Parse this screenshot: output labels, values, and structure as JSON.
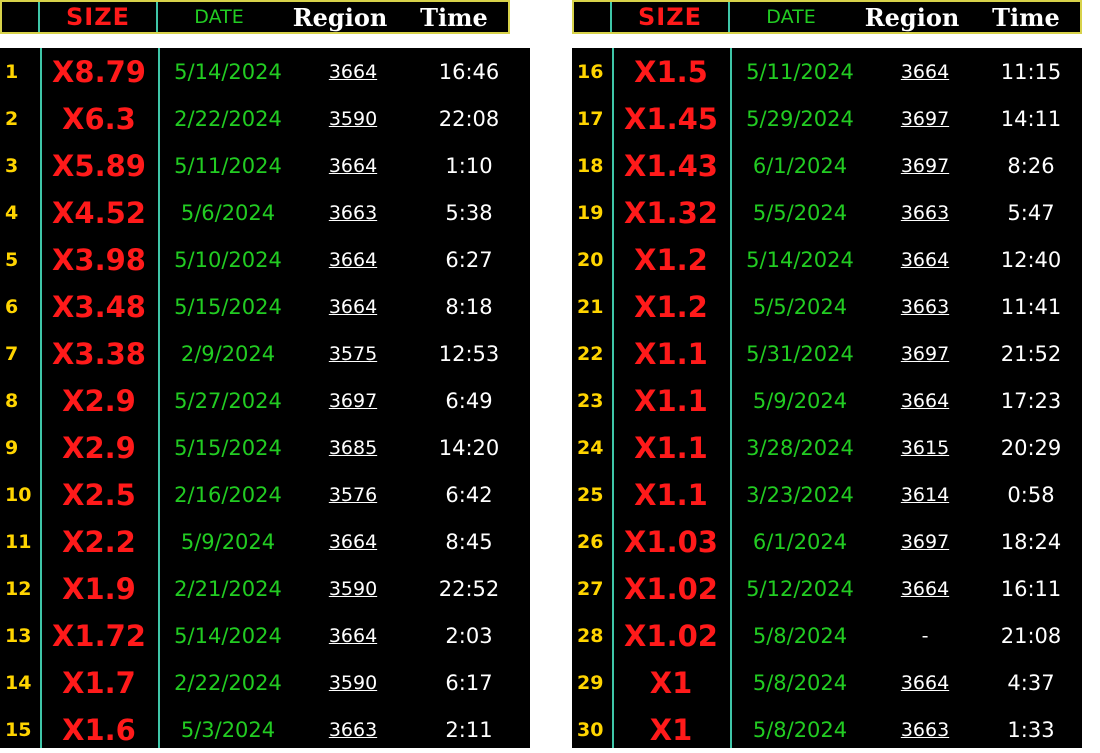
{
  "headers": {
    "num": "",
    "size": "SIZE",
    "date": "DATE",
    "region": "Region",
    "time": "Time"
  },
  "left_rows": [
    {
      "num": "1",
      "size": "X8.79",
      "date": "5/14/2024",
      "region": "3664",
      "time": "16:46"
    },
    {
      "num": "2",
      "size": "X6.3",
      "date": "2/22/2024",
      "region": "3590",
      "time": "22:08"
    },
    {
      "num": "3",
      "size": "X5.89",
      "date": "5/11/2024",
      "region": "3664",
      "time": "1:10"
    },
    {
      "num": "4",
      "size": "X4.52",
      "date": "5/6/2024",
      "region": "3663",
      "time": "5:38"
    },
    {
      "num": "5",
      "size": "X3.98",
      "date": "5/10/2024",
      "region": "3664",
      "time": "6:27"
    },
    {
      "num": "6",
      "size": "X3.48",
      "date": "5/15/2024",
      "region": "3664",
      "time": "8:18"
    },
    {
      "num": "7",
      "size": "X3.38",
      "date": "2/9/2024",
      "region": "3575",
      "time": "12:53"
    },
    {
      "num": "8",
      "size": "X2.9",
      "date": "5/27/2024",
      "region": "3697",
      "time": "6:49"
    },
    {
      "num": "9",
      "size": "X2.9",
      "date": "5/15/2024",
      "region": "3685",
      "time": "14:20"
    },
    {
      "num": "10",
      "size": "X2.5",
      "date": "2/16/2024",
      "region": "3576",
      "time": "6:42"
    },
    {
      "num": "11",
      "size": "X2.2",
      "date": "5/9/2024",
      "region": "3664",
      "time": "8:45"
    },
    {
      "num": "12",
      "size": "X1.9",
      "date": "2/21/2024",
      "region": "3590",
      "time": "22:52"
    },
    {
      "num": "13",
      "size": "X1.72",
      "date": "5/14/2024",
      "region": "3664",
      "time": "2:03"
    },
    {
      "num": "14",
      "size": "X1.7",
      "date": "2/22/2024",
      "region": "3590",
      "time": "6:17"
    },
    {
      "num": "15",
      "size": "X1.6",
      "date": "5/3/2024",
      "region": "3663",
      "time": "2:11"
    }
  ],
  "right_rows": [
    {
      "num": "16",
      "size": "X1.5",
      "date": "5/11/2024",
      "region": "3664",
      "time": "11:15"
    },
    {
      "num": "17",
      "size": "X1.45",
      "date": "5/29/2024",
      "region": "3697",
      "time": "14:11"
    },
    {
      "num": "18",
      "size": "X1.43",
      "date": "6/1/2024",
      "region": "3697",
      "time": "8:26"
    },
    {
      "num": "19",
      "size": "X1.32",
      "date": "5/5/2024",
      "region": "3663",
      "time": "5:47"
    },
    {
      "num": "20",
      "size": "X1.2",
      "date": "5/14/2024",
      "region": "3664",
      "time": "12:40"
    },
    {
      "num": "21",
      "size": "X1.2",
      "date": "5/5/2024",
      "region": "3663",
      "time": "11:41"
    },
    {
      "num": "22",
      "size": "X1.1",
      "date": "5/31/2024",
      "region": "3697",
      "time": "21:52"
    },
    {
      "num": "23",
      "size": "X1.1",
      "date": "5/9/2024",
      "region": "3664",
      "time": "17:23"
    },
    {
      "num": "24",
      "size": "X1.1",
      "date": "3/28/2024",
      "region": "3615",
      "time": "20:29"
    },
    {
      "num": "25",
      "size": "X1.1",
      "date": "3/23/2024",
      "region": "3614",
      "time": "0:58"
    },
    {
      "num": "26",
      "size": "X1.03",
      "date": "6/1/2024",
      "region": "3697",
      "time": "18:24"
    },
    {
      "num": "27",
      "size": "X1.02",
      "date": "5/12/2024",
      "region": "3664",
      "time": "16:11"
    },
    {
      "num": "28",
      "size": "X1.02",
      "date": "5/8/2024",
      "region": "-",
      "time": "21:08"
    },
    {
      "num": "29",
      "size": "X1",
      "date": "5/8/2024",
      "region": "3664",
      "time": "4:37"
    },
    {
      "num": "30",
      "size": "X1",
      "date": "5/8/2024",
      "region": "3663",
      "time": "1:33"
    }
  ]
}
